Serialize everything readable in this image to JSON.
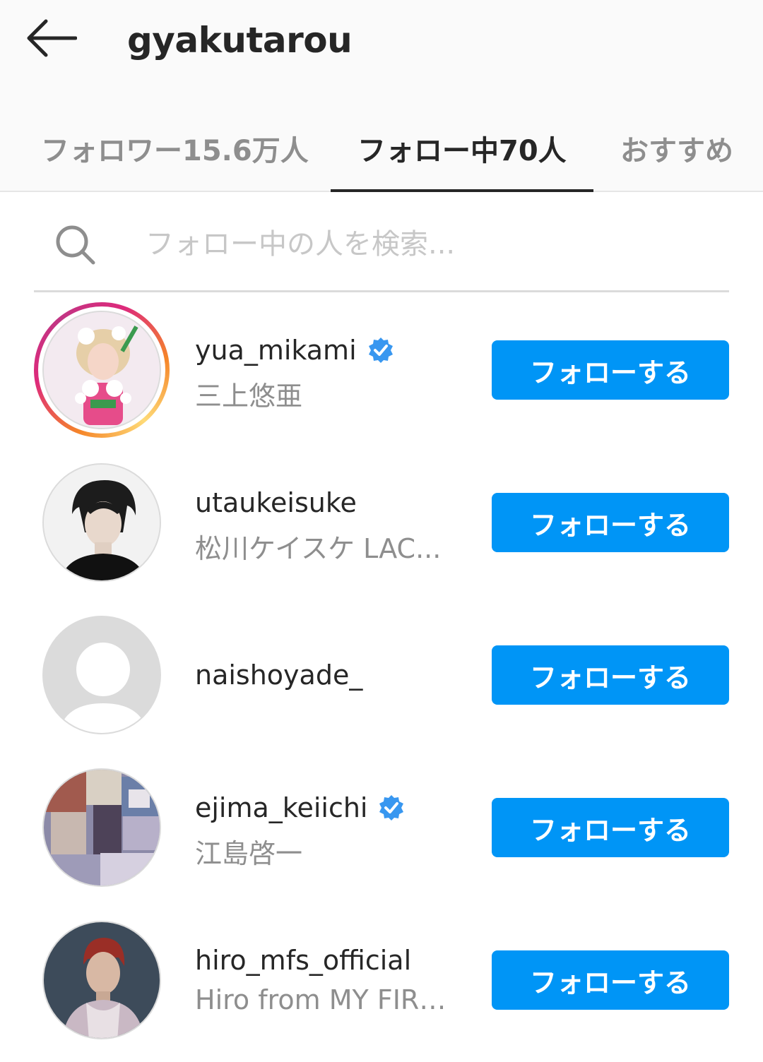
{
  "header": {
    "title": "gyakutarou",
    "back_icon": "back-arrow-icon"
  },
  "tabs": [
    {
      "label": "フォロワー15.6万人",
      "active": false
    },
    {
      "label": "フォロー中70人",
      "active": true
    },
    {
      "label": "おすすめ",
      "active": false
    }
  ],
  "search": {
    "placeholder": "フォロー中の人を検索..."
  },
  "users": [
    {
      "username": "yua_mikami",
      "full_name": "三上悠亜",
      "verified": true,
      "has_story": true,
      "button": "フォローする"
    },
    {
      "username": "utaukeisuke",
      "full_name": "松川ケイスケ LAC...",
      "verified": false,
      "has_story": false,
      "button": "フォローする"
    },
    {
      "username": "naishoyade_",
      "full_name": "",
      "verified": false,
      "has_story": false,
      "button": "フォローする"
    },
    {
      "username": "ejima_keiichi",
      "full_name": "江島啓一",
      "verified": true,
      "has_story": false,
      "button": "フォローする"
    },
    {
      "username": "hiro_mfs_official",
      "full_name": "Hiro from MY FIRS...",
      "verified": false,
      "has_story": false,
      "button": "フォローする"
    }
  ],
  "colors": {
    "accent": "#0095f6",
    "verified": "#3897f0",
    "secondary_text": "#8e8e8e"
  }
}
